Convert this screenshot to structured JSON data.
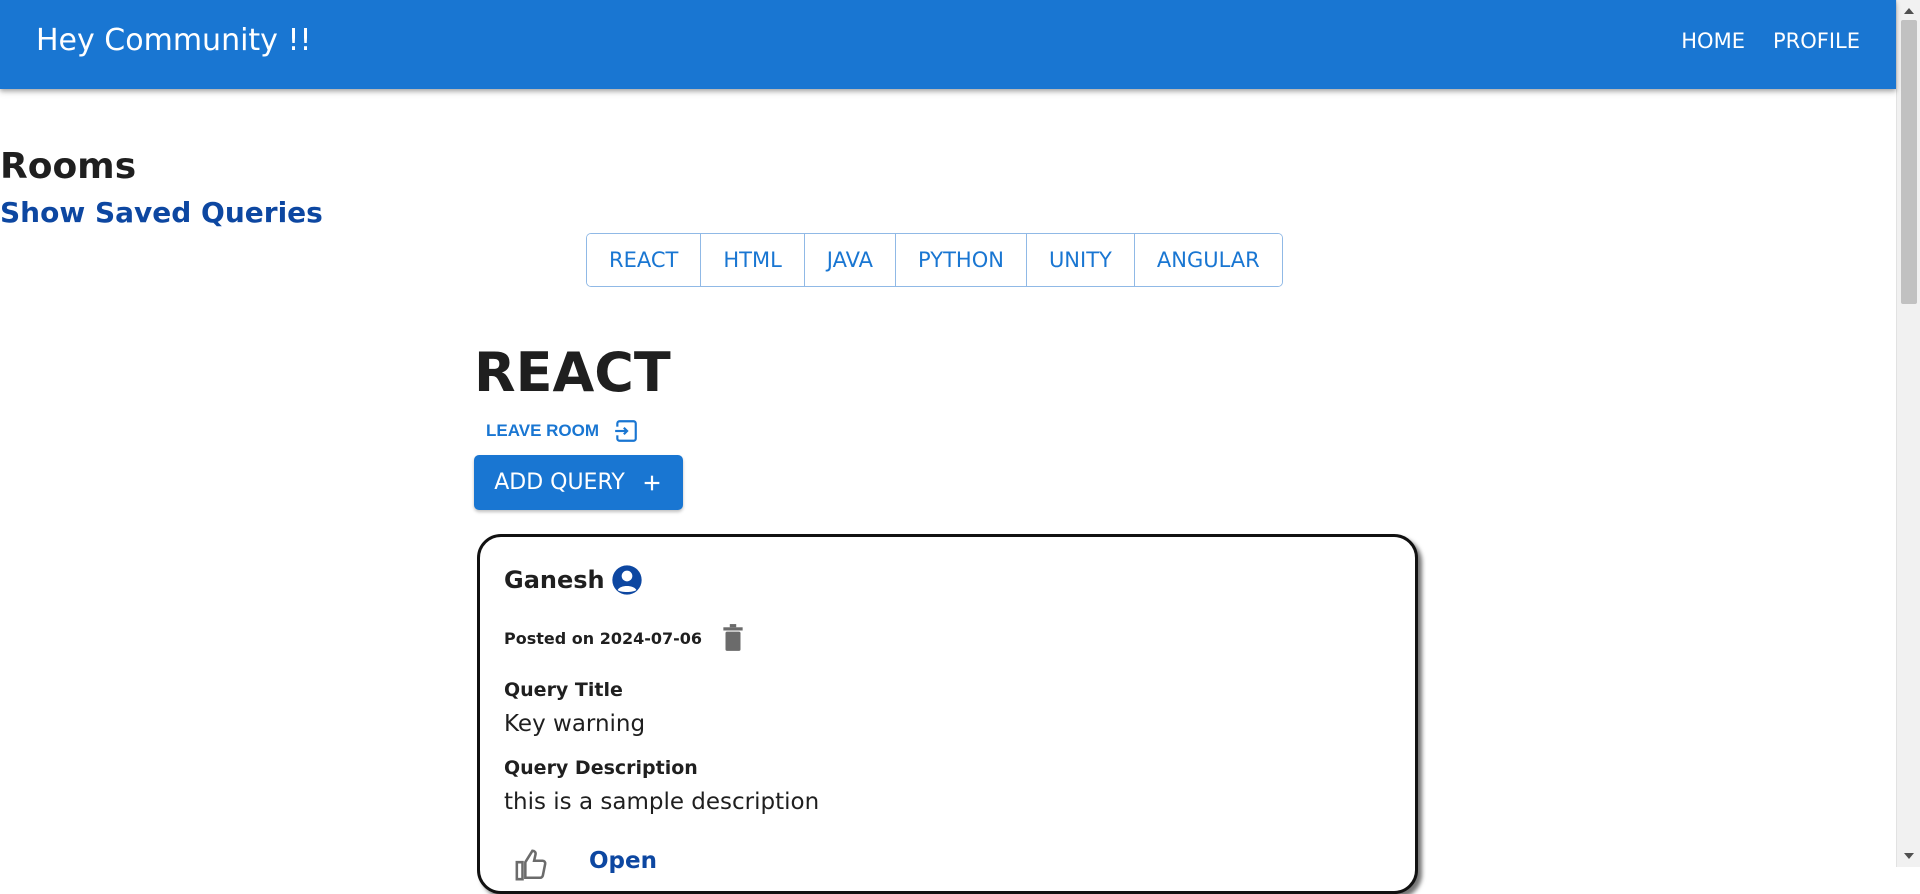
{
  "header": {
    "brand": "Hey Community !!",
    "nav": [
      "HOME",
      "PROFILE"
    ]
  },
  "sidebar": {
    "title": "Rooms",
    "saved_link": "Show Saved Queries"
  },
  "room_tabs": [
    "REACT",
    "HTML",
    "JAVA",
    "PYTHON",
    "UNITY",
    "ANGULAR"
  ],
  "room": {
    "name": "REACT",
    "leave_label": "LEAVE ROOM",
    "add_label": "ADD QUERY"
  },
  "query": {
    "author": "Ganesh",
    "posted_label": "Posted on 2024-07-06",
    "title_label": "Query Title",
    "title_value": "Key warning",
    "desc_label": "Query Description",
    "desc_value": "this is a sample description",
    "open_label": "Open"
  },
  "icons": {
    "leave": "logout-icon",
    "add": "plus-icon",
    "avatar": "account-circle-icon",
    "delete": "trash-icon",
    "like": "thumb-up-icon"
  },
  "colors": {
    "primary": "#1976d2",
    "link": "#0d47a1",
    "tab_border": "#90b9e6",
    "trash": "#6b6b6b"
  }
}
